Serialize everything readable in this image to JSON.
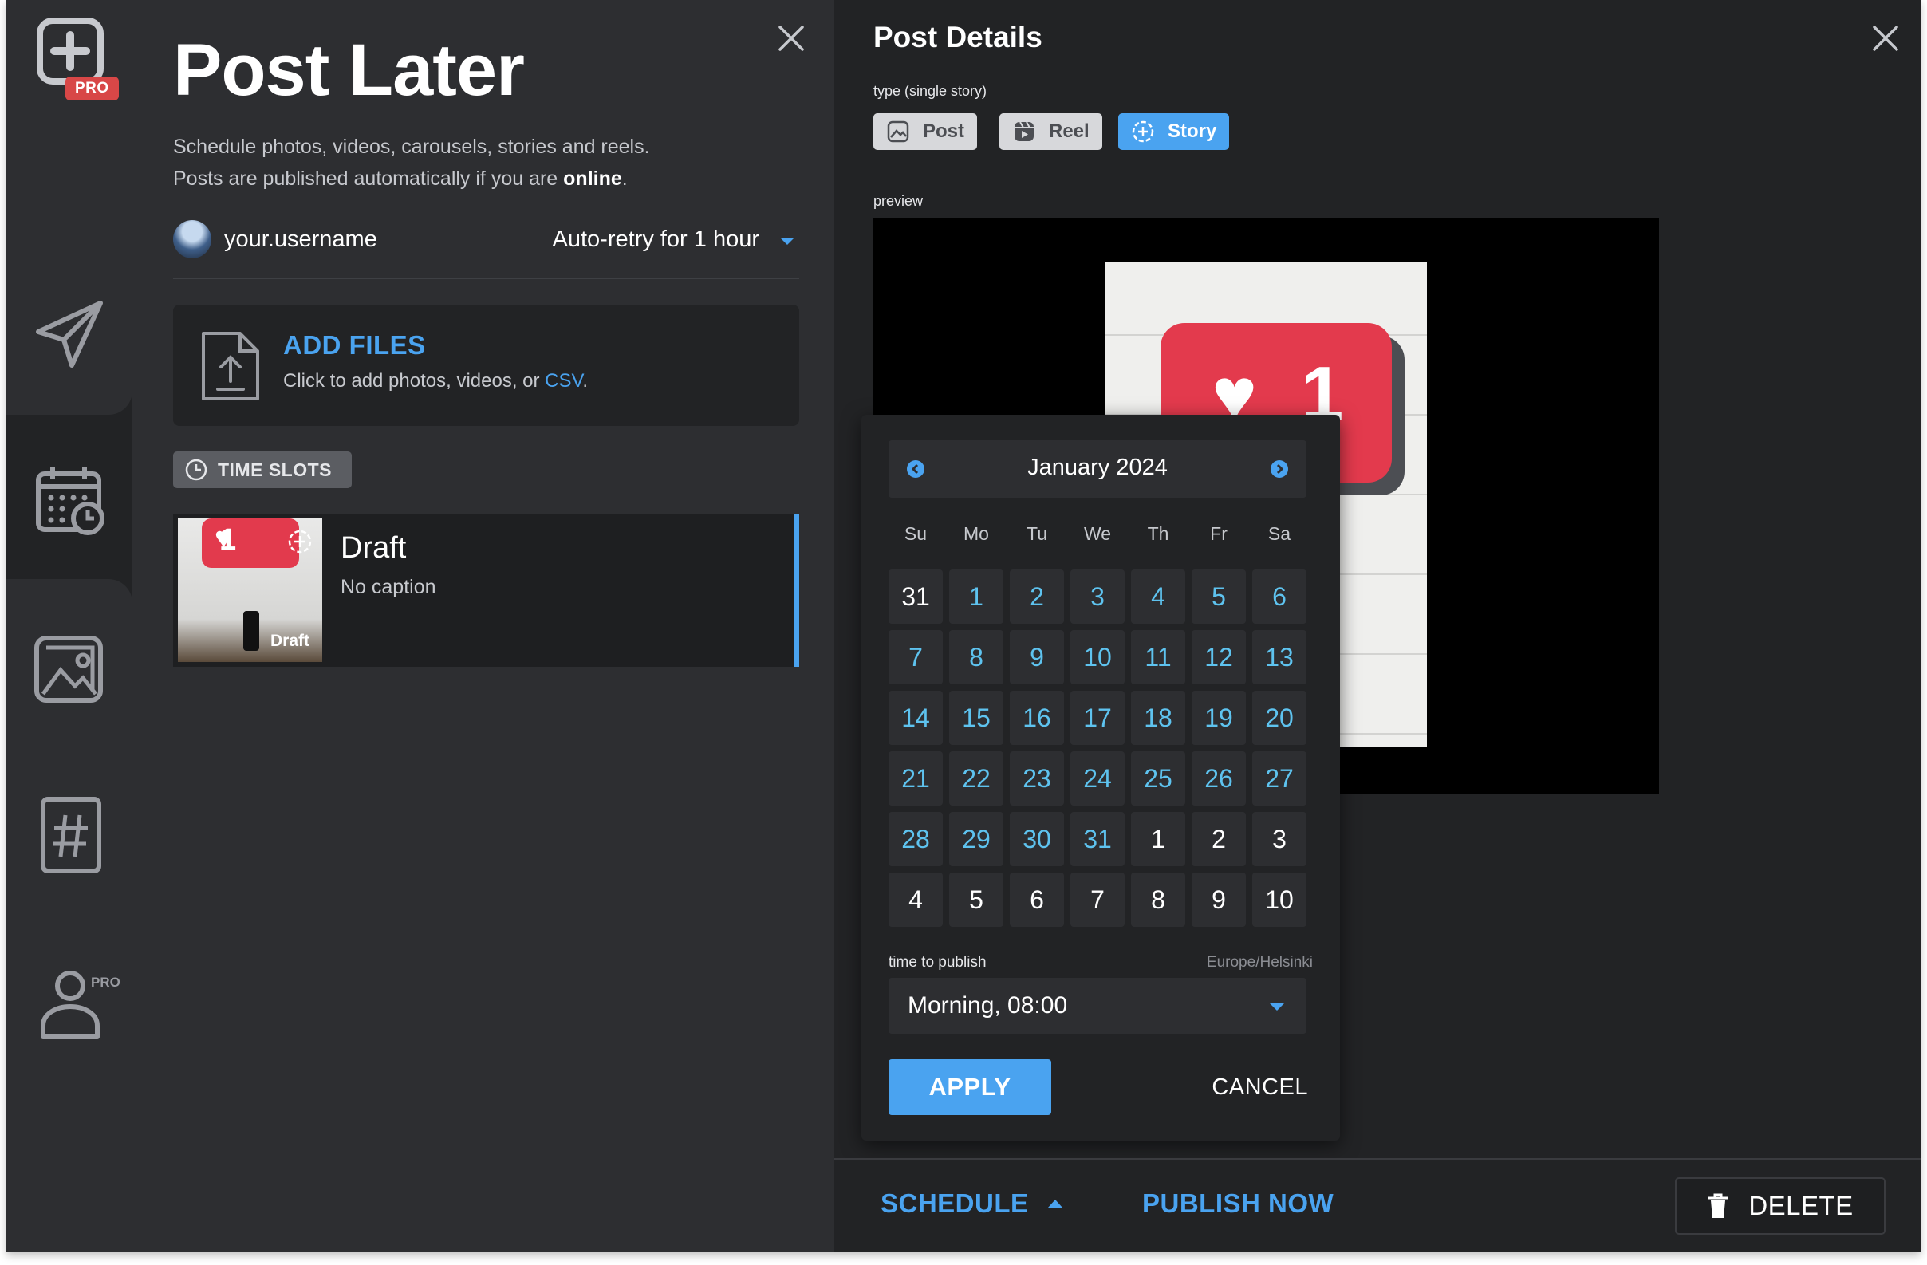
{
  "sidebar": {
    "pro_badge": "PRO",
    "profile_pro": "PRO"
  },
  "left": {
    "title": "Post Later",
    "description_line1": "Schedule photos, videos, carousels, stories and reels.",
    "description_line2_prefix": "Posts are published automatically if you are ",
    "description_line2_bold": "online",
    "description_line2_suffix": ".",
    "username": "your.username",
    "retry_option": "Auto-retry for 1 hour",
    "add_files_title": "ADD FILES",
    "add_files_sub_prefix": "Click to add photos, videos, or ",
    "add_files_sub_link": "CSV",
    "add_files_sub_suffix": ".",
    "time_slots_label": "TIME SLOTS",
    "draft": {
      "title": "Draft",
      "caption": "No caption",
      "thumb_label": "Draft",
      "thumb_count": "1"
    }
  },
  "details": {
    "title": "Post Details",
    "type_label": "type (single story)",
    "types": [
      {
        "label": "Post",
        "active": false
      },
      {
        "label": "Reel",
        "active": false
      },
      {
        "label": "Story",
        "active": true
      }
    ],
    "preview_label": "preview",
    "preview_count": "1"
  },
  "datepicker": {
    "month": "January 2024",
    "weekdays": [
      "Su",
      "Mo",
      "Tu",
      "We",
      "Th",
      "Fr",
      "Sa"
    ],
    "weeks": [
      [
        {
          "d": "31",
          "cur": false
        },
        {
          "d": "1",
          "cur": true
        },
        {
          "d": "2",
          "cur": true
        },
        {
          "d": "3",
          "cur": true
        },
        {
          "d": "4",
          "cur": true
        },
        {
          "d": "5",
          "cur": true
        },
        {
          "d": "6",
          "cur": true
        }
      ],
      [
        {
          "d": "7",
          "cur": true
        },
        {
          "d": "8",
          "cur": true
        },
        {
          "d": "9",
          "cur": true
        },
        {
          "d": "10",
          "cur": true
        },
        {
          "d": "11",
          "cur": true
        },
        {
          "d": "12",
          "cur": true
        },
        {
          "d": "13",
          "cur": true
        }
      ],
      [
        {
          "d": "14",
          "cur": true
        },
        {
          "d": "15",
          "cur": true
        },
        {
          "d": "16",
          "cur": true
        },
        {
          "d": "17",
          "cur": true
        },
        {
          "d": "18",
          "cur": true
        },
        {
          "d": "19",
          "cur": true
        },
        {
          "d": "20",
          "cur": true
        }
      ],
      [
        {
          "d": "21",
          "cur": true
        },
        {
          "d": "22",
          "cur": true
        },
        {
          "d": "23",
          "cur": true
        },
        {
          "d": "24",
          "cur": true
        },
        {
          "d": "25",
          "cur": true
        },
        {
          "d": "26",
          "cur": true
        },
        {
          "d": "27",
          "cur": true
        }
      ],
      [
        {
          "d": "28",
          "cur": true
        },
        {
          "d": "29",
          "cur": true
        },
        {
          "d": "30",
          "cur": true
        },
        {
          "d": "31",
          "cur": true
        },
        {
          "d": "1",
          "cur": false
        },
        {
          "d": "2",
          "cur": false
        },
        {
          "d": "3",
          "cur": false
        }
      ],
      [
        {
          "d": "4",
          "cur": false
        },
        {
          "d": "5",
          "cur": false
        },
        {
          "d": "6",
          "cur": false
        },
        {
          "d": "7",
          "cur": false
        },
        {
          "d": "8",
          "cur": false
        },
        {
          "d": "9",
          "cur": false
        },
        {
          "d": "10",
          "cur": false
        }
      ]
    ],
    "time_label": "time to publish",
    "timezone": "Europe/Helsinki",
    "time_value": "Morning, 08:00",
    "apply_label": "APPLY",
    "cancel_label": "CANCEL"
  },
  "bottom": {
    "schedule_label": "SCHEDULE",
    "publish_label": "PUBLISH NOW",
    "delete_label": "DELETE"
  },
  "colors": {
    "accent": "#4aa3f0",
    "calendar_current": "#5ec3ef",
    "pro_badge": "#d84747",
    "panel_bg": "#2d2e31",
    "dark_bg": "#222325"
  }
}
